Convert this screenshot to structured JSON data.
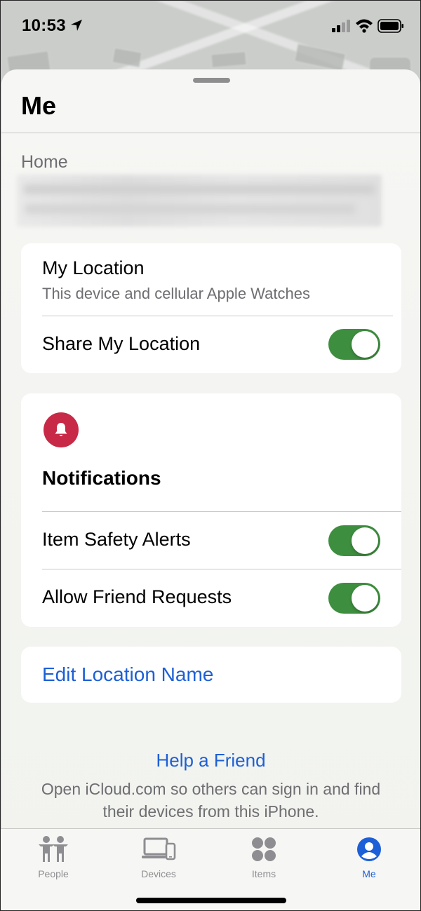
{
  "status_bar": {
    "time": "10:53",
    "icons": [
      "location-arrow-icon",
      "cellular-signal-icon",
      "wifi-icon",
      "battery-icon"
    ]
  },
  "sheet": {
    "title": "Me",
    "home_label": "Home"
  },
  "my_location_card": {
    "title": "My Location",
    "subtitle": "This device and cellular Apple Watches",
    "share_label": "Share My Location",
    "share_enabled": true
  },
  "notifications_card": {
    "icon": "bell-icon",
    "title": "Notifications",
    "rows": [
      {
        "label": "Item Safety Alerts",
        "enabled": true
      },
      {
        "label": "Allow Friend Requests",
        "enabled": true
      }
    ]
  },
  "edit_location": {
    "label": "Edit Location Name"
  },
  "help": {
    "title": "Help a Friend",
    "text": "Open iCloud.com so others can sign in and find their devices from this iPhone."
  },
  "tabs": [
    {
      "label": "People",
      "icon": "people-icon",
      "active": false
    },
    {
      "label": "Devices",
      "icon": "devices-icon",
      "active": false
    },
    {
      "label": "Items",
      "icon": "items-icon",
      "active": false
    },
    {
      "label": "Me",
      "icon": "me-icon",
      "active": true
    }
  ],
  "colors": {
    "accent": "#1d5fd6",
    "toggle_on": "#3e8e3f",
    "bell_bg": "#c72946"
  }
}
